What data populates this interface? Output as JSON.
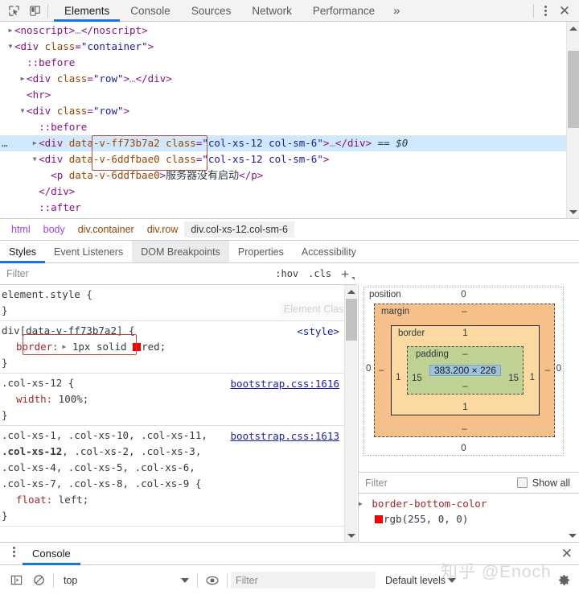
{
  "toolbar": {
    "inspect_icon": "inspect-cursor-icon",
    "device_icon": "device-toolbar-icon",
    "tabs": [
      {
        "label": "Elements",
        "active": true
      },
      {
        "label": "Console",
        "active": false
      },
      {
        "label": "Sources",
        "active": false
      },
      {
        "label": "Network",
        "active": false
      },
      {
        "label": "Performance",
        "active": false
      }
    ],
    "more_label": "»",
    "menu_icon": "kebab-menu-icon",
    "close_label": "✕",
    "accent": "#1a73e8"
  },
  "dom": {
    "rows": [
      {
        "indent": 0,
        "tri": "▶",
        "ellipsis": "",
        "parts": [
          {
            "t": "punc",
            "v": "<"
          },
          {
            "t": "tag",
            "v": "noscript"
          },
          {
            "t": "punc",
            "v": ">"
          },
          {
            "t": "dimmed",
            "v": "…"
          },
          {
            "t": "punc",
            "v": "</"
          },
          {
            "t": "tag",
            "v": "noscript"
          },
          {
            "t": "punc",
            "v": ">"
          }
        ]
      },
      {
        "indent": 0,
        "tri": "▼",
        "ellipsis": "",
        "parts": [
          {
            "t": "punc",
            "v": "<"
          },
          {
            "t": "tag",
            "v": "div"
          },
          {
            "t": "txt",
            "v": " "
          },
          {
            "t": "attr",
            "v": "class"
          },
          {
            "t": "punc",
            "v": "="
          },
          {
            "t": "val",
            "v": "\"container\""
          },
          {
            "t": "punc",
            "v": ">"
          }
        ]
      },
      {
        "indent": 1,
        "tri": "",
        "ellipsis": "",
        "parts": [
          {
            "t": "pseudo",
            "v": "::before"
          }
        ]
      },
      {
        "indent": 1,
        "tri": "▶",
        "ellipsis": "",
        "parts": [
          {
            "t": "punc",
            "v": "<"
          },
          {
            "t": "tag",
            "v": "div"
          },
          {
            "t": "txt",
            "v": " "
          },
          {
            "t": "attr",
            "v": "class"
          },
          {
            "t": "punc",
            "v": "="
          },
          {
            "t": "val",
            "v": "\"row\""
          },
          {
            "t": "punc",
            "v": ">"
          },
          {
            "t": "dimmed",
            "v": "…"
          },
          {
            "t": "punc",
            "v": "</"
          },
          {
            "t": "tag",
            "v": "div"
          },
          {
            "t": "punc",
            "v": ">"
          }
        ]
      },
      {
        "indent": 1,
        "tri": "",
        "ellipsis": "",
        "parts": [
          {
            "t": "punc",
            "v": "<"
          },
          {
            "t": "tag",
            "v": "hr"
          },
          {
            "t": "punc",
            "v": ">"
          }
        ]
      },
      {
        "indent": 1,
        "tri": "▼",
        "ellipsis": "",
        "parts": [
          {
            "t": "punc",
            "v": "<"
          },
          {
            "t": "tag",
            "v": "div"
          },
          {
            "t": "txt",
            "v": " "
          },
          {
            "t": "attr",
            "v": "class"
          },
          {
            "t": "punc",
            "v": "="
          },
          {
            "t": "val",
            "v": "\"row\""
          },
          {
            "t": "punc",
            "v": ">"
          }
        ]
      },
      {
        "indent": 2,
        "tri": "",
        "ellipsis": "",
        "parts": [
          {
            "t": "pseudo",
            "v": "::before"
          }
        ]
      },
      {
        "indent": 2,
        "tri": "▶",
        "ellipsis": "…",
        "selected": true,
        "parts": [
          {
            "t": "punc",
            "v": "<"
          },
          {
            "t": "tag",
            "v": "div"
          },
          {
            "t": "txt",
            "v": " "
          },
          {
            "t": "attr",
            "v": "data-v-ff73b7a2"
          },
          {
            "t": "txt",
            "v": " "
          },
          {
            "t": "attr",
            "v": "class"
          },
          {
            "t": "punc",
            "v": "="
          },
          {
            "t": "val",
            "v": "\"col-xs-12 col-sm-6\""
          },
          {
            "t": "punc",
            "v": ">"
          },
          {
            "t": "dimmed",
            "v": "…"
          },
          {
            "t": "punc",
            "v": "</"
          },
          {
            "t": "tag",
            "v": "div"
          },
          {
            "t": "punc",
            "v": ">"
          },
          {
            "t": "txt",
            "v": "  "
          },
          {
            "t": "refvar",
            "v": "== $0"
          }
        ]
      },
      {
        "indent": 2,
        "tri": "▼",
        "ellipsis": "",
        "parts": [
          {
            "t": "punc",
            "v": "<"
          },
          {
            "t": "tag",
            "v": "div"
          },
          {
            "t": "txt",
            "v": " "
          },
          {
            "t": "attr",
            "v": "data-v-6ddfbae0"
          },
          {
            "t": "txt",
            "v": " "
          },
          {
            "t": "attr",
            "v": "class"
          },
          {
            "t": "punc",
            "v": "="
          },
          {
            "t": "val",
            "v": "\"col-xs-12 col-sm-6\""
          },
          {
            "t": "punc",
            "v": ">"
          }
        ]
      },
      {
        "indent": 3,
        "tri": "",
        "ellipsis": "",
        "parts": [
          {
            "t": "punc",
            "v": "<"
          },
          {
            "t": "tag",
            "v": "p"
          },
          {
            "t": "txt",
            "v": " "
          },
          {
            "t": "attr",
            "v": "data-v-6ddfbae0"
          },
          {
            "t": "punc",
            "v": ">"
          },
          {
            "t": "cn",
            "v": "服务器没有启动"
          },
          {
            "t": "punc",
            "v": "</"
          },
          {
            "t": "tag",
            "v": "p"
          },
          {
            "t": "punc",
            "v": ">"
          }
        ]
      },
      {
        "indent": 2,
        "tri": "",
        "ellipsis": "",
        "parts": [
          {
            "t": "punc",
            "v": "</"
          },
          {
            "t": "tag",
            "v": "div"
          },
          {
            "t": "punc",
            "v": ">"
          }
        ]
      },
      {
        "indent": 2,
        "tri": "",
        "ellipsis": "",
        "parts": [
          {
            "t": "pseudo",
            "v": "::after"
          }
        ]
      }
    ],
    "annotation_color": "#b5483d"
  },
  "breadcrumb": [
    {
      "label": "html",
      "kind": "tag"
    },
    {
      "label": "body",
      "kind": "tag"
    },
    {
      "label": "div.container",
      "kind": "cls"
    },
    {
      "label": "div.row",
      "kind": "cls"
    },
    {
      "label": "div.col-xs-12.col-sm-6",
      "kind": "active"
    }
  ],
  "sidebar_tabs": [
    {
      "label": "Styles",
      "active": true
    },
    {
      "label": "Event Listeners",
      "active": false
    },
    {
      "label": "DOM Breakpoints",
      "active": false,
      "pressed": true
    },
    {
      "label": "Properties",
      "active": false
    },
    {
      "label": "Accessibility",
      "active": false
    }
  ],
  "styles": {
    "filter_placeholder": "Filter",
    "hov_label": ":hov",
    "cls_label": ".cls",
    "plus_label": "+",
    "element_classes_ghost": "Element Classes",
    "rules": [
      {
        "selector": "element.style {",
        "source": "",
        "declarations": [],
        "close": "}"
      },
      {
        "selector": "div[data-v-ff73b7a2] {",
        "source": "<style>",
        "source_link": false,
        "declarations": [
          {
            "expandable": true,
            "prop": "border",
            "value": "1px solid ",
            "swatch": "#ff0000",
            "value_after": "red;"
          }
        ],
        "close": "}"
      },
      {
        "selector": ".col-xs-12 {",
        "source": "bootstrap.css:1616",
        "source_link": true,
        "declarations": [
          {
            "expandable": false,
            "prop": "width",
            "value": "100%;"
          }
        ],
        "close": "}"
      },
      {
        "selector_html": ".col-xs-1, .col-xs-10, .col-xs-11, <b>.col-xs-12</b>, .col-xs-2, .col-xs-3, .col-xs-4, .col-xs-5, .col-xs-6, .col-xs-7, .col-xs-8, .col-xs-9 {",
        "source": "bootstrap.css:1613",
        "source_link": true,
        "declarations": [
          {
            "expandable": false,
            "prop": "float",
            "value": "left;"
          }
        ],
        "close": "}"
      }
    ]
  },
  "box_model": {
    "position_label": "position",
    "margin_label": "margin",
    "border_label": "border",
    "padding_label": "padding",
    "content": "383.200 × 226",
    "position": {
      "top": "0",
      "right": "0",
      "bottom": "0",
      "left": "0"
    },
    "margin": {
      "top": "–",
      "right": "–",
      "bottom": "–",
      "left": "–"
    },
    "border": {
      "top": "1",
      "right": "1",
      "bottom": "1",
      "left": "1"
    },
    "padding": {
      "top": "–",
      "right": "15",
      "bottom": "–",
      "left": "15"
    },
    "colors": {
      "margin": "#f6c08a",
      "border": "#fbd9a0",
      "padding": "#c0d194",
      "content": "#9cc3db"
    }
  },
  "computed": {
    "filter_placeholder": "Filter",
    "show_all_label": "Show all",
    "show_all_checked": false,
    "properties": [
      {
        "name": "border-bottom-color",
        "value": "rgb(255, 0, 0)",
        "swatch": "#ff0000",
        "expandable": true
      }
    ]
  },
  "drawer": {
    "menu_icon": "kebab-menu-icon",
    "tab_label": "Console",
    "close_label": "✕",
    "sidebar_icon": "console-sidebar-icon",
    "clear_icon": "clear-console-icon",
    "context": "top",
    "eye_icon": "live-expression-icon",
    "filter_placeholder": "Filter",
    "levels_label": "Default levels",
    "settings_icon": "gear-icon"
  },
  "watermark": "知乎 @Enoch"
}
